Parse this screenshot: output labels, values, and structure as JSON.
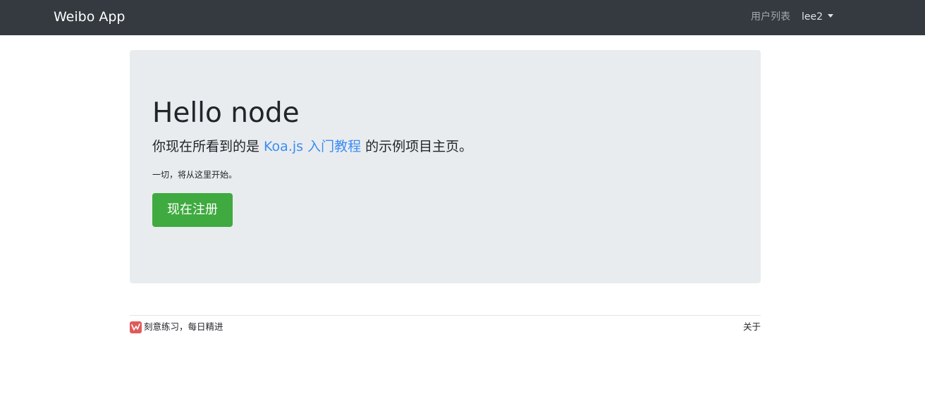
{
  "navbar": {
    "brand": "Weibo App",
    "users_link": "用户列表",
    "current_user": "lee2"
  },
  "hero": {
    "title": "Hello node",
    "lead_before": "你现在所看到的是 ",
    "lead_link": "Koa.js 入门教程",
    "lead_after": " 的示例项目主页。",
    "subtext": "一切，将从这里开始。",
    "register_button": "现在注册"
  },
  "footer": {
    "logo_icon": "brand-logo-icon",
    "slogan": "刻意练习，每日精进",
    "about": "关于"
  },
  "colors": {
    "navbar_bg": "#343a40",
    "jumbotron_bg": "#e9ecef",
    "link": "#3b8cf5",
    "success_button": "#3faa3f",
    "logo": "#e05a5a"
  }
}
